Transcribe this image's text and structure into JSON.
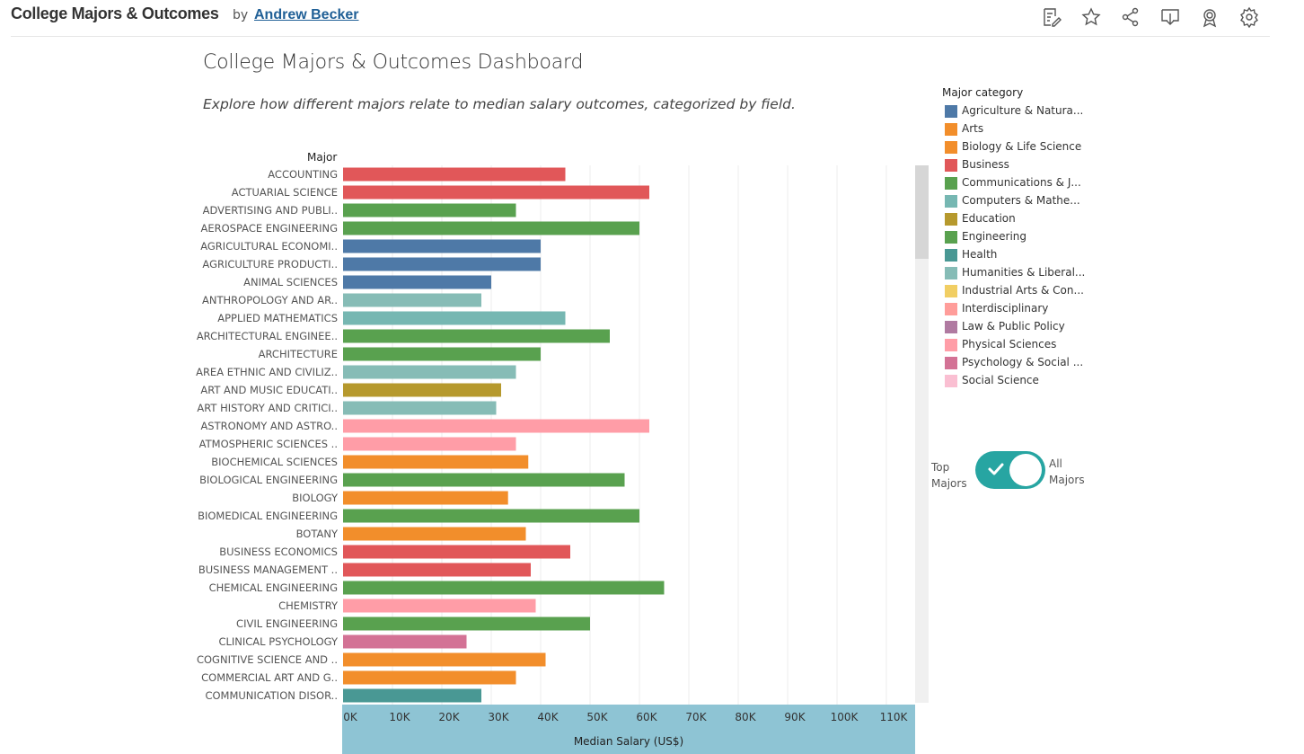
{
  "header": {
    "viz_title": "College Majors & Outcomes",
    "by": "by",
    "author": "Andrew Becker",
    "toolbar": [
      {
        "icon": "edit-icon"
      },
      {
        "icon": "star-icon"
      },
      {
        "icon": "share-icon"
      },
      {
        "icon": "download-icon"
      },
      {
        "icon": "award-icon"
      },
      {
        "icon": "gear-icon"
      }
    ]
  },
  "dashboard": {
    "title": "College Majors & Outcomes Dashboard",
    "subtitle": "Explore how different majors relate to median salary outcomes, categorized by field."
  },
  "legend": {
    "title": "Major category",
    "items": [
      {
        "label": "Agriculture & Natura...",
        "color": "#4e79a7"
      },
      {
        "label": "Arts",
        "color": "#f28e2b"
      },
      {
        "label": "Biology & Life Science",
        "color": "#f28e2b"
      },
      {
        "label": "Business",
        "color": "#e15759"
      },
      {
        "label": "Communications & J...",
        "color": "#59a14f"
      },
      {
        "label": "Computers & Mathe...",
        "color": "#76b7b2"
      },
      {
        "label": "Education",
        "color": "#b6992d"
      },
      {
        "label": "Engineering",
        "color": "#59a14f"
      },
      {
        "label": "Health",
        "color": "#499894"
      },
      {
        "label": "Humanities & Liberal...",
        "color": "#86bcb6"
      },
      {
        "label": "Industrial Arts & Con...",
        "color": "#f1ce63"
      },
      {
        "label": "Interdisciplinary",
        "color": "#ff9d9a"
      },
      {
        "label": "Law & Public Policy",
        "color": "#b07aa1"
      },
      {
        "label": "Physical Sciences",
        "color": "#ff9da7"
      },
      {
        "label": "Psychology & Social ...",
        "color": "#d37295"
      },
      {
        "label": "Social Science",
        "color": "#fabfd2"
      }
    ]
  },
  "toggle": {
    "left_line1": "Top",
    "left_line2": "Majors",
    "right_line1": "All",
    "right_line2": "Majors",
    "state": "on"
  },
  "chart_data": {
    "type": "bar",
    "orientation": "horizontal",
    "y_header": "Major",
    "xlabel": "Median Salary (US$)",
    "xlim": [
      0,
      115000
    ],
    "x_ticks": [
      "0K",
      "10K",
      "20K",
      "30K",
      "40K",
      "50K",
      "60K",
      "70K",
      "80K",
      "90K",
      "100K",
      "110K"
    ],
    "grid": true,
    "bars": [
      {
        "label": "ACCOUNTING",
        "value": 45000,
        "color": "#e15759"
      },
      {
        "label": "ACTUARIAL SCIENCE",
        "value": 62000,
        "color": "#e15759"
      },
      {
        "label": "ADVERTISING AND PUBLI..",
        "value": 35000,
        "color": "#59a14f"
      },
      {
        "label": "AEROSPACE ENGINEERING",
        "value": 60000,
        "color": "#59a14f"
      },
      {
        "label": "AGRICULTURAL ECONOMI..",
        "value": 40000,
        "color": "#4e79a7"
      },
      {
        "label": "AGRICULTURE PRODUCTI..",
        "value": 40000,
        "color": "#4e79a7"
      },
      {
        "label": "ANIMAL SCIENCES",
        "value": 30000,
        "color": "#4e79a7"
      },
      {
        "label": "ANTHROPOLOGY AND AR..",
        "value": 28000,
        "color": "#86bcb6"
      },
      {
        "label": "APPLIED MATHEMATICS",
        "value": 45000,
        "color": "#76b7b2"
      },
      {
        "label": "ARCHITECTURAL ENGINEE..",
        "value": 54000,
        "color": "#59a14f"
      },
      {
        "label": "ARCHITECTURE",
        "value": 40000,
        "color": "#59a14f"
      },
      {
        "label": "AREA ETHNIC AND CIVILIZ..",
        "value": 35000,
        "color": "#86bcb6"
      },
      {
        "label": "ART AND MUSIC EDUCATI..",
        "value": 32000,
        "color": "#b6992d"
      },
      {
        "label": "ART HISTORY AND CRITICI..",
        "value": 31000,
        "color": "#86bcb6"
      },
      {
        "label": "ASTRONOMY AND ASTRO..",
        "value": 62000,
        "color": "#ff9da7"
      },
      {
        "label": "ATMOSPHERIC SCIENCES ..",
        "value": 35000,
        "color": "#ff9da7"
      },
      {
        "label": "BIOCHEMICAL SCIENCES",
        "value": 37500,
        "color": "#f28e2b"
      },
      {
        "label": "BIOLOGICAL ENGINEERING",
        "value": 57000,
        "color": "#59a14f"
      },
      {
        "label": "BIOLOGY",
        "value": 33400,
        "color": "#f28e2b"
      },
      {
        "label": "BIOMEDICAL ENGINEERING",
        "value": 60000,
        "color": "#59a14f"
      },
      {
        "label": "BOTANY",
        "value": 37000,
        "color": "#f28e2b"
      },
      {
        "label": "BUSINESS ECONOMICS",
        "value": 46000,
        "color": "#e15759"
      },
      {
        "label": "BUSINESS MANAGEMENT ..",
        "value": 38000,
        "color": "#e15759"
      },
      {
        "label": "CHEMICAL ENGINEERING",
        "value": 65000,
        "color": "#59a14f"
      },
      {
        "label": "CHEMISTRY",
        "value": 39000,
        "color": "#ff9da7"
      },
      {
        "label": "CIVIL ENGINEERING",
        "value": 50000,
        "color": "#59a14f"
      },
      {
        "label": "CLINICAL PSYCHOLOGY",
        "value": 25000,
        "color": "#d37295"
      },
      {
        "label": "COGNITIVE SCIENCE AND ..",
        "value": 41000,
        "color": "#f28e2b"
      },
      {
        "label": "COMMERCIAL ART AND G..",
        "value": 35000,
        "color": "#f28e2b"
      },
      {
        "label": "COMMUNICATION DISOR..",
        "value": 28000,
        "color": "#499894"
      }
    ]
  }
}
